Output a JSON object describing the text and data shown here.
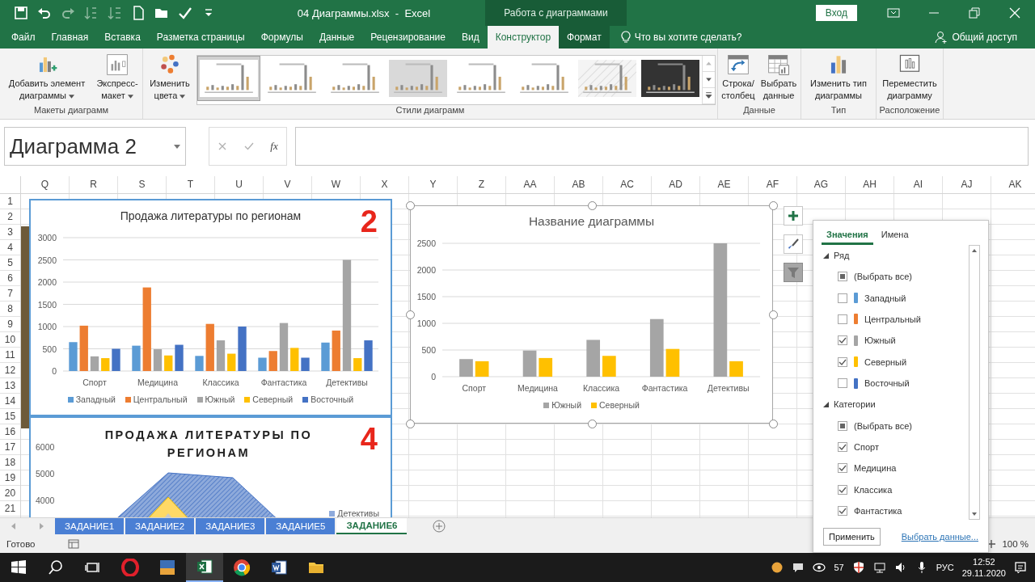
{
  "window": {
    "title": "04 Диаграммы.xlsx  -  Excel",
    "context_title": "Работа с диаграммами",
    "sign_in": "Вход"
  },
  "qat": [
    {
      "kind": "save",
      "disabled": false
    },
    {
      "kind": "undo",
      "disabled": false
    },
    {
      "kind": "redo",
      "disabled": true
    },
    {
      "kind": "sort_asc",
      "disabled": true
    },
    {
      "kind": "sort_desc",
      "disabled": true
    },
    {
      "kind": "new",
      "disabled": false
    },
    {
      "kind": "open",
      "disabled": false
    },
    {
      "kind": "spelling",
      "disabled": false
    },
    {
      "kind": "customize",
      "disabled": false
    }
  ],
  "ribbon_tabs": [
    {
      "label": "Файл",
      "selected": false,
      "contextual": false
    },
    {
      "label": "Главная",
      "selected": false,
      "contextual": false
    },
    {
      "label": "Вставка",
      "selected": false,
      "contextual": false
    },
    {
      "label": "Разметка страницы",
      "selected": false,
      "contextual": false
    },
    {
      "label": "Формулы",
      "selected": false,
      "contextual": false
    },
    {
      "label": "Данные",
      "selected": false,
      "contextual": false
    },
    {
      "label": "Рецензирование",
      "selected": false,
      "contextual": false
    },
    {
      "label": "Вид",
      "selected": false,
      "contextual": false
    },
    {
      "label": "Конструктор",
      "selected": true,
      "contextual": true
    },
    {
      "label": "Формат",
      "selected": false,
      "contextual": true
    }
  ],
  "tell_me": "Что вы хотите сделать?",
  "share": "Общий доступ",
  "ribbon_groups": [
    {
      "label": "Макеты диаграмм",
      "buttons": [
        {
          "kind": "add_element",
          "label": "Добавить элемент диаграммы",
          "dropdown": true
        },
        {
          "kind": "quick_layout",
          "label": "Экспресс-макет",
          "dropdown": true
        }
      ]
    },
    {
      "label": "Стили диаграмм",
      "buttons": [
        {
          "kind": "colors",
          "label": "Изменить цвета",
          "dropdown": true
        }
      ],
      "gallery": [
        {
          "kind": "plain",
          "selected": true
        },
        {
          "kind": "plain",
          "selected": false
        },
        {
          "kind": "plain",
          "selected": false
        },
        {
          "kind": "gray",
          "selected": false
        },
        {
          "kind": "plain",
          "selected": false
        },
        {
          "kind": "plain",
          "selected": false
        },
        {
          "kind": "hatched",
          "selected": false
        },
        {
          "kind": "dark",
          "selected": false
        }
      ]
    },
    {
      "label": "Данные",
      "buttons": [
        {
          "kind": "switch",
          "label": "Строка/ столбец",
          "dropdown": false
        },
        {
          "kind": "select_data",
          "label": "Выбрать данные",
          "dropdown": false
        }
      ]
    },
    {
      "label": "Тип",
      "buttons": [
        {
          "kind": "change_type",
          "label": "Изменить тип диаграммы",
          "dropdown": false
        }
      ]
    },
    {
      "label": "Расположение",
      "buttons": [
        {
          "kind": "move",
          "label": "Переместить диаграмму",
          "dropdown": false
        }
      ]
    }
  ],
  "formula_bar": {
    "name_box": "Диаграмма 2",
    "function_label": "fx"
  },
  "columns": [
    "Q",
    "R",
    "S",
    "T",
    "U",
    "V",
    "W",
    "X",
    "Y",
    "Z",
    "AA",
    "AB",
    "AC",
    "AD",
    "AE",
    "AF",
    "AG",
    "AH",
    "AI",
    "AJ",
    "AK"
  ],
  "rows": [
    "1",
    "2",
    "3",
    "4",
    "5",
    "6",
    "7",
    "8",
    "9",
    "10",
    "11",
    "12",
    "13",
    "14",
    "15",
    "16",
    "17",
    "18",
    "19",
    "20",
    "21"
  ],
  "charts": [
    {
      "kind": "bar",
      "number": "2",
      "selected": false,
      "chart_data": {
        "type": "bar",
        "title": "Продажа литературы по регионам",
        "categories": [
          "Спорт",
          "Медицина",
          "Классика",
          "Фантастика",
          "Детективы"
        ],
        "ylim": [
          0,
          3000
        ],
        "yticks": [
          0,
          500,
          1000,
          1500,
          2000,
          2500,
          3000
        ],
        "grid": true,
        "series": [
          {
            "name": "Западный",
            "color": "#5b9bd5",
            "values": [
              650,
              570,
              340,
              300,
              640
            ]
          },
          {
            "name": "Центральный",
            "color": "#ed7d31",
            "values": [
              1020,
              1880,
              1060,
              450,
              910
            ]
          },
          {
            "name": "Южный",
            "color": "#a5a5a5",
            "values": [
              330,
              490,
              690,
              1080,
              2500
            ]
          },
          {
            "name": "Северный",
            "color": "#ffc000",
            "values": [
              290,
              350,
              390,
              520,
              290
            ]
          },
          {
            "name": "Восточный",
            "color": "#4472c4",
            "values": [
              500,
              590,
              1000,
              300,
              690
            ]
          }
        ]
      }
    },
    {
      "kind": "area_picture",
      "number": "4",
      "selected": false,
      "title": "ПРОДАЖА ЛИТЕРАТУРЫ ПО РЕГИОНАМ",
      "axis_labels": [
        "6000",
        "5000",
        "4000"
      ],
      "legend": [
        "Детективы"
      ]
    },
    {
      "kind": "bar",
      "selected": true,
      "chart_data": {
        "type": "bar",
        "title": "Название диаграммы",
        "categories": [
          "Спорт",
          "Медицина",
          "Классика",
          "Фантастика",
          "Детективы"
        ],
        "ylim": [
          0,
          2500
        ],
        "yticks": [
          0,
          500,
          1000,
          1500,
          2000,
          2500
        ],
        "grid": true,
        "series": [
          {
            "name": "Южный",
            "color": "#a5a5a5",
            "values": [
              330,
              490,
              690,
              1080,
              2500
            ]
          },
          {
            "name": "Северный",
            "color": "#ffc000",
            "values": [
              290,
              350,
              390,
              520,
              290
            ]
          }
        ]
      }
    }
  ],
  "chart_tools": [
    {
      "kind": "add",
      "selected": false
    },
    {
      "kind": "style",
      "selected": false
    },
    {
      "kind": "filter",
      "selected": true
    }
  ],
  "filter_pane": {
    "tabs": [
      {
        "label": "Значения",
        "selected": true
      },
      {
        "label": "Имена",
        "selected": false
      }
    ],
    "sections": [
      {
        "label": "Ряд",
        "expanded": true,
        "items": [
          {
            "label": "(Выбрать все)",
            "mixed": true
          },
          {
            "label": "Западный",
            "checked": false,
            "color": "#5b9bd5"
          },
          {
            "label": "Центральный",
            "checked": false,
            "color": "#ed7d31"
          },
          {
            "label": "Южный",
            "checked": true,
            "color": "#a5a5a5"
          },
          {
            "label": "Северный",
            "checked": true,
            "color": "#ffc000"
          },
          {
            "label": "Восточный",
            "checked": false,
            "color": "#4472c4"
          }
        ]
      },
      {
        "label": "Категории",
        "expanded": true,
        "items": [
          {
            "label": "(Выбрать все)",
            "mixed": true
          },
          {
            "label": "Спорт",
            "checked": true
          },
          {
            "label": "Медицина",
            "checked": true
          },
          {
            "label": "Классика",
            "checked": true
          },
          {
            "label": "Фантастика",
            "checked": true
          }
        ]
      }
    ],
    "apply": "Применить",
    "link": "Выбрать данные..."
  },
  "sheet_tabs": [
    {
      "label": "ЗАДАНИЕ1",
      "selected": false
    },
    {
      "label": "ЗАДАНИЕ2",
      "selected": false
    },
    {
      "label": "ЗАДАНИЕ3",
      "selected": false
    },
    {
      "label": "ЗАДАНИЕ5",
      "selected": false
    },
    {
      "label": "ЗАДАНИЕ6",
      "selected": true
    }
  ],
  "status_bar": {
    "text": "Готово",
    "zoom": "100 %"
  },
  "taskbar": {
    "apps": [
      {
        "kind": "opera",
        "active": false
      },
      {
        "kind": "devtool",
        "active": false
      },
      {
        "kind": "excel",
        "active": true
      },
      {
        "kind": "chrome",
        "active": false
      },
      {
        "kind": "word",
        "active": false
      },
      {
        "kind": "explorer",
        "active": false
      }
    ],
    "badge": "57",
    "language": "РУС",
    "time": "12:52",
    "date": "29.11.2020"
  }
}
